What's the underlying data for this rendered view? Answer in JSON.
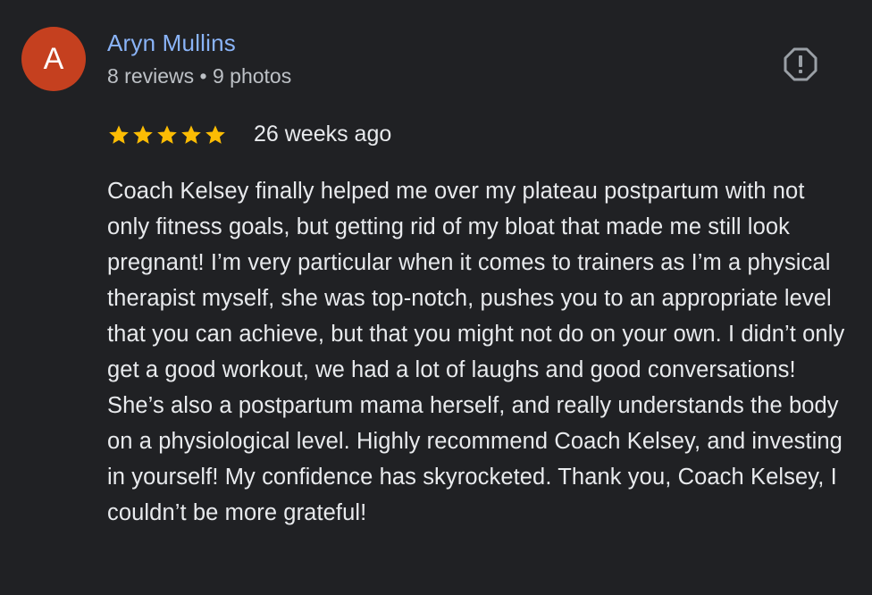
{
  "reviewer": {
    "avatar_letter": "A",
    "avatar_color": "#c5401f",
    "name": "Aryn Mullins",
    "name_color": "#8ab4f8",
    "meta": "8 reviews • 9 photos"
  },
  "report_icon": "report-flag-icon",
  "rating": {
    "stars": 5,
    "max_stars": 5,
    "star_color": "#fbbc04",
    "date": "26 weeks ago"
  },
  "review_text": "Coach Kelsey finally helped me over my plateau postpartum with not only fitness goals, but getting rid of my bloat that made me still look pregnant! I’m very particular when it comes to trainers as I’m a physical therapist myself, she was top-notch, pushes you to an appropriate level that you can achieve, but that you might not do on your own. I didn’t only get a good workout, we had a lot of laughs and good conversations! She’s also a postpartum mama herself, and really understands the body on a physiological level. Highly recommend Coach Kelsey, and investing in yourself! My confidence has skyrocketed. Thank you, Coach Kelsey, I couldn’t be more grateful!",
  "colors": {
    "background": "#202124",
    "text": "#e8eaed",
    "secondary_text": "#bdc1c6"
  }
}
